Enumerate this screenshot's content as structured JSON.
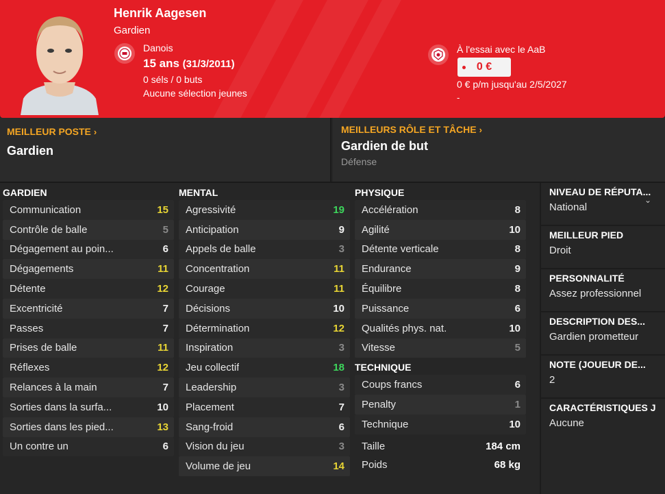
{
  "header": {
    "name": "Henrik Aagesen",
    "position": "Gardien",
    "nationality": "Danois",
    "age": "15 ans",
    "dob": "(31/3/2011)",
    "caps": "0 séls / 0 buts",
    "youth_caps": "Aucune sélection jeunes",
    "trial": "À l'essai avec le AaB",
    "value": "0 €",
    "contract": "0 € p/m jusqu'au 2/5/2027",
    "contract_extra": "-",
    "accent_color": "#e41e26"
  },
  "best_position": {
    "label": "MEILLEUR POSTE",
    "value": "Gardien"
  },
  "best_role": {
    "label": "MEILLEURS RÔLE ET TÂCHE",
    "value": "Gardien de but",
    "duty": "Défense"
  },
  "attributes": {
    "goalkeeping": {
      "title": "GARDIEN",
      "items": [
        {
          "name": "Communication",
          "value": "15"
        },
        {
          "name": "Contrôle de balle",
          "value": "5"
        },
        {
          "name": "Dégagement au poin...",
          "value": "6"
        },
        {
          "name": "Dégagements",
          "value": "11"
        },
        {
          "name": "Détente",
          "value": "12"
        },
        {
          "name": "Excentricité",
          "value": "7"
        },
        {
          "name": "Passes",
          "value": "7"
        },
        {
          "name": "Prises de balle",
          "value": "11"
        },
        {
          "name": "Réflexes",
          "value": "12"
        },
        {
          "name": "Relances à la main",
          "value": "7"
        },
        {
          "name": "Sorties dans la surfa...",
          "value": "10"
        },
        {
          "name": "Sorties dans les pied...",
          "value": "13"
        },
        {
          "name": "Un contre un",
          "value": "6"
        }
      ]
    },
    "mental": {
      "title": "MENTAL",
      "items": [
        {
          "name": "Agressivité",
          "value": "19"
        },
        {
          "name": "Anticipation",
          "value": "9"
        },
        {
          "name": "Appels de balle",
          "value": "3"
        },
        {
          "name": "Concentration",
          "value": "11"
        },
        {
          "name": "Courage",
          "value": "11"
        },
        {
          "name": "Décisions",
          "value": "10"
        },
        {
          "name": "Détermination",
          "value": "12"
        },
        {
          "name": "Inspiration",
          "value": "3"
        },
        {
          "name": "Jeu collectif",
          "value": "18"
        },
        {
          "name": "Leadership",
          "value": "3"
        },
        {
          "name": "Placement",
          "value": "7"
        },
        {
          "name": "Sang-froid",
          "value": "6"
        },
        {
          "name": "Vision du jeu",
          "value": "3"
        },
        {
          "name": "Volume de jeu",
          "value": "14"
        }
      ]
    },
    "physical": {
      "title": "PHYSIQUE",
      "items": [
        {
          "name": "Accélération",
          "value": "8"
        },
        {
          "name": "Agilité",
          "value": "10"
        },
        {
          "name": "Détente verticale",
          "value": "8"
        },
        {
          "name": "Endurance",
          "value": "9"
        },
        {
          "name": "Équilibre",
          "value": "8"
        },
        {
          "name": "Puissance",
          "value": "6"
        },
        {
          "name": "Qualités phys. nat.",
          "value": "10"
        },
        {
          "name": "Vitesse",
          "value": "5"
        }
      ]
    },
    "technical": {
      "title": "TECHNIQUE",
      "items": [
        {
          "name": "Coups francs",
          "value": "6"
        },
        {
          "name": "Penalty",
          "value": "1"
        },
        {
          "name": "Technique",
          "value": "10"
        }
      ]
    },
    "body": [
      {
        "name": "Taille",
        "value": "184 cm"
      },
      {
        "name": "Poids",
        "value": "68 kg"
      }
    ]
  },
  "info": [
    {
      "label": "NIVEAU DE RÉPUTA...",
      "value": "National",
      "dropdown": true
    },
    {
      "label": "MEILLEUR PIED",
      "value": "Droit"
    },
    {
      "label": "PERSONNALITÉ",
      "value": "Assez professionnel"
    },
    {
      "label": "DESCRIPTION DES...",
      "value": "Gardien prometteur"
    },
    {
      "label": "NOTE (JOUEUR DE...",
      "value": "2"
    },
    {
      "label": "CARACTÉRISTIQUES J",
      "value": "Aucune"
    }
  ],
  "value_colors": {
    "grey": "#8a8a8a",
    "white": "#f2f2f2",
    "yellow": "#e8d534",
    "green": "#3dd65c"
  }
}
